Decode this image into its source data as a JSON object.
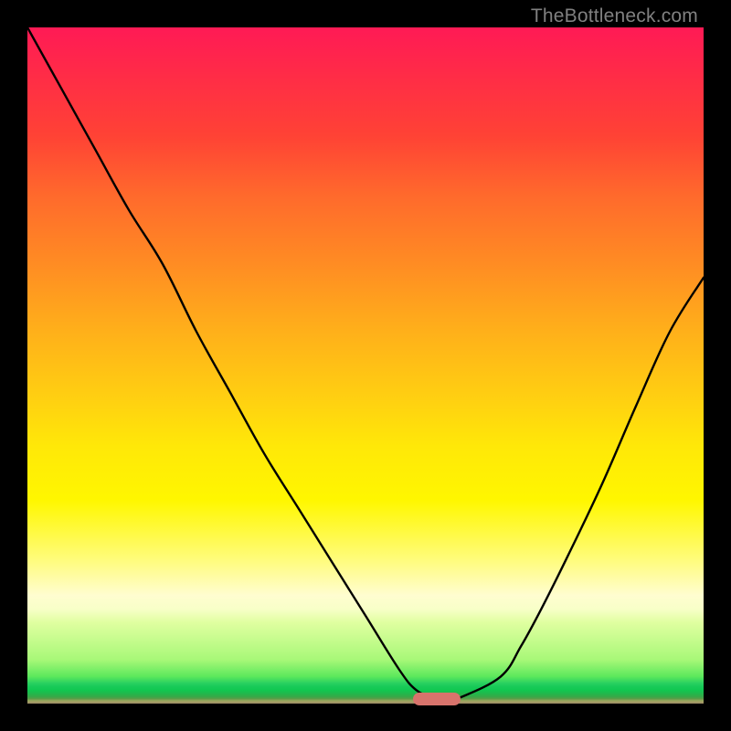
{
  "watermark_text": "TheBottleneck.com",
  "colors": {
    "gradient_top": "#ff1a55",
    "gradient_bottom": "#a08c68",
    "curve": "#000000",
    "marker": "#d8736c",
    "page_bg": "#000000",
    "watermark": "#808080"
  },
  "chart_data": {
    "type": "line",
    "title": "",
    "xlabel": "",
    "ylabel": "",
    "xlim": [
      0,
      100
    ],
    "ylim": [
      0,
      100
    ],
    "series": [
      {
        "name": "curve",
        "x": [
          0,
          5,
          10,
          15,
          20,
          25,
          30,
          35,
          40,
          45,
          50,
          55,
          57.5,
          60,
          62,
          64,
          70,
          73,
          76,
          80,
          85,
          90,
          95,
          100
        ],
        "values": [
          100,
          91,
          82,
          73,
          65,
          55,
          46,
          37,
          29,
          21,
          13,
          5,
          2,
          0.9,
          0.6,
          0.9,
          4,
          8.5,
          14,
          22,
          32.5,
          44,
          55,
          63
        ]
      }
    ],
    "marker": {
      "x_start": 57,
      "x_end": 64,
      "y": 0.7
    },
    "annotations": []
  }
}
